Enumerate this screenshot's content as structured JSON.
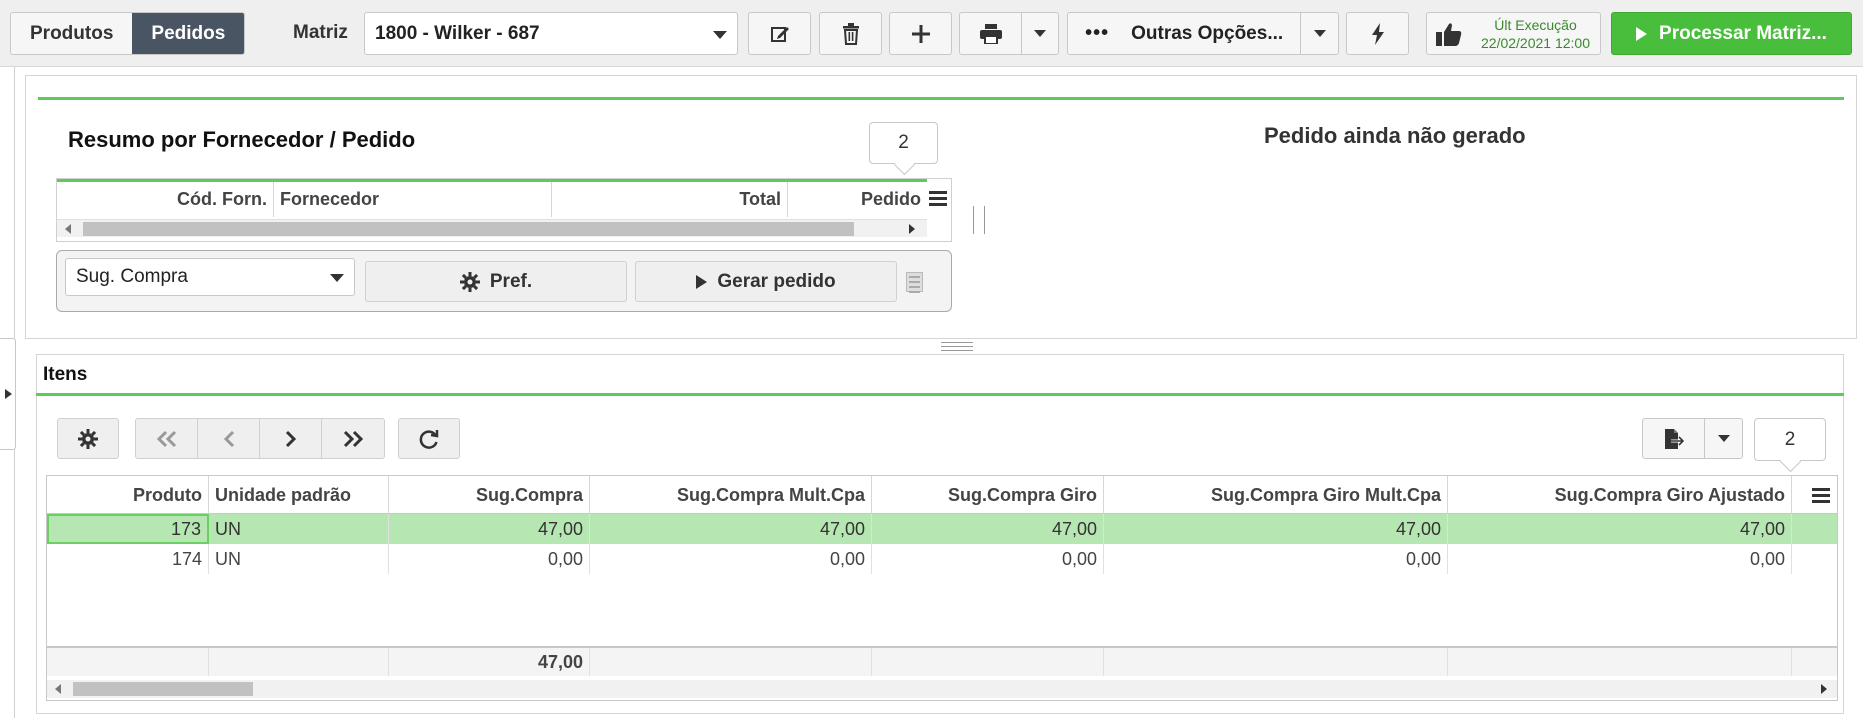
{
  "topbar": {
    "tabs": [
      {
        "label": "Produtos",
        "active": false
      },
      {
        "label": "Pedidos",
        "active": true
      }
    ],
    "matriz_label": "Matriz",
    "matriz_value": "1800 - Wilker - 687",
    "more_options_label": "Outras Opções...",
    "last_exec_label": "Últ Execução",
    "last_exec_value": "22/02/2021 12:00",
    "process_label": "Processar Matriz..."
  },
  "summary": {
    "title": "Resumo por Fornecedor / Pedido",
    "count_badge": "2",
    "columns": [
      "Cód. Forn.",
      "Fornecedor",
      "Total",
      "Pedido"
    ],
    "order_status": "Pedido ainda não gerado",
    "view_select": "Sug. Compra",
    "pref_label": "Pref.",
    "generate_label": "Gerar pedido"
  },
  "items": {
    "title": "Itens",
    "count_badge": "2",
    "columns": [
      "Produto",
      "Unidade padrão",
      "Sug.Compra",
      "Sug.Compra Mult.Cpa",
      "Sug.Compra Giro",
      "Sug.Compra Giro Mult.Cpa",
      "Sug.Compra Giro Ajustado"
    ],
    "rows": [
      [
        "173",
        "UN",
        "47,00",
        "47,00",
        "47,00",
        "47,00",
        "47,00"
      ],
      [
        "174",
        "UN",
        "0,00",
        "0,00",
        "0,00",
        "0,00",
        "0,00"
      ]
    ],
    "footer_total": "47,00"
  },
  "colors": {
    "accent_green": "#49be3c",
    "selected_row": "#b6e7b2",
    "active_tab": "#4a5563"
  },
  "icons": [
    "edit-icon",
    "trash-icon",
    "plus-icon",
    "print-icon",
    "ellipsis-icon",
    "bolt-icon",
    "thumbs-up-icon",
    "play-icon",
    "gear-icon",
    "first-page-icon",
    "prev-page-icon",
    "next-page-icon",
    "last-page-icon",
    "refresh-icon",
    "export-icon",
    "menu-icon"
  ]
}
